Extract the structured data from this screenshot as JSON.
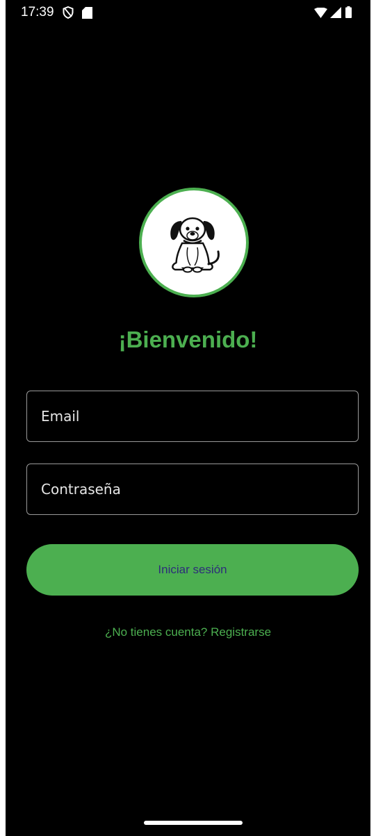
{
  "status_bar": {
    "time": "17:39",
    "icons": [
      "shield-icon",
      "sd-card-icon",
      "wifi-icon",
      "cell-signal-icon",
      "battery-icon"
    ]
  },
  "logo": {
    "icon": "dog-icon",
    "border_color": "#4caf50"
  },
  "welcome": {
    "title": "¡Bienvenido!"
  },
  "form": {
    "email_placeholder": "Email",
    "email_value": "",
    "password_placeholder": "Contraseña",
    "password_value": ""
  },
  "actions": {
    "login_label": "Iniciar sesión",
    "register_label": "¿No tienes cuenta? Registrarse"
  },
  "colors": {
    "accent": "#4caf50",
    "background": "#000000",
    "button_text": "#2d2d7a"
  }
}
